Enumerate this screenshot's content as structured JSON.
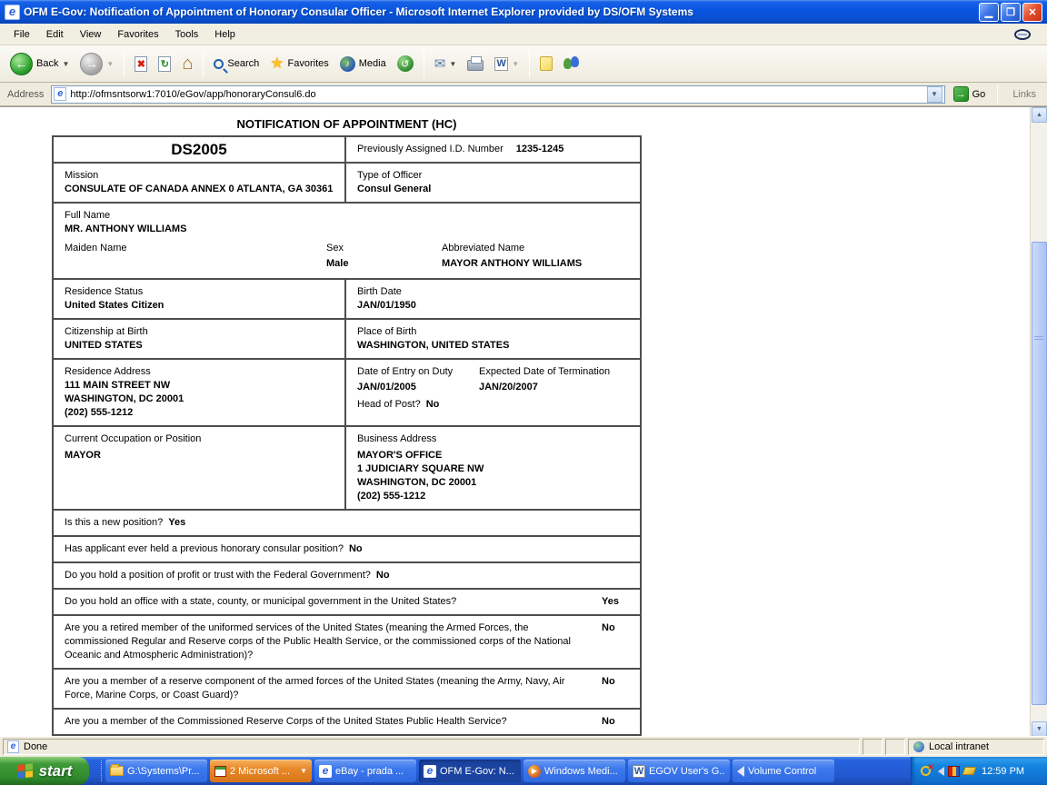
{
  "window": {
    "title": "OFM E-Gov: Notification of Appointment of Honorary Consular Officer - Microsoft Internet Explorer provided by DS/OFM Systems"
  },
  "menu_items": [
    "File",
    "Edit",
    "View",
    "Favorites",
    "Tools",
    "Help"
  ],
  "toolbar": {
    "back": "Back",
    "search": "Search",
    "favorites": "Favorites",
    "media": "Media"
  },
  "address": {
    "label": "Address",
    "url": "http://ofmsntsorw1:7010/eGov/app/honoraryConsul6.do",
    "go": "Go",
    "links": "Links"
  },
  "form": {
    "title": "NOTIFICATION OF APPOINTMENT (HC)",
    "form_number": "DS2005",
    "prev_id": {
      "label": "Previously Assigned I.D. Number",
      "value": "1235-1245"
    },
    "mission": {
      "label": "Mission",
      "value": "CONSULATE OF CANADA ANNEX 0 ATLANTA, GA 30361"
    },
    "type_of_officer": {
      "label": "Type of Officer",
      "value": "Consul General"
    },
    "full_name": {
      "label": "Full Name",
      "value": "MR. ANTHONY WILLIAMS"
    },
    "maiden_name": {
      "label": "Maiden Name",
      "value": ""
    },
    "sex": {
      "label": "Sex",
      "value": "Male"
    },
    "abbreviated_name": {
      "label": "Abbreviated Name",
      "value": "MAYOR ANTHONY WILLIAMS"
    },
    "residence_status": {
      "label": "Residence Status",
      "value": "United States Citizen"
    },
    "birth_date": {
      "label": "Birth Date",
      "value": "JAN/01/1950"
    },
    "citizenship_at_birth": {
      "label": "Citizenship at Birth",
      "value": "UNITED STATES"
    },
    "place_of_birth": {
      "label": "Place of Birth",
      "value": "WASHINGTON, UNITED STATES"
    },
    "residence_address": {
      "label": "Residence Address",
      "lines": [
        "111 MAIN STREET NW",
        "WASHINGTON, DC 20001",
        "(202) 555-1212"
      ]
    },
    "entry_on_duty": {
      "label": "Date of Entry on Duty",
      "value": "JAN/01/2005"
    },
    "termination": {
      "label": "Expected Date of Termination",
      "value": "JAN/20/2007"
    },
    "head_of_post": {
      "label": "Head of Post?",
      "value": "No"
    },
    "occupation": {
      "label": "Current Occupation or Position",
      "value": "MAYOR"
    },
    "business_address": {
      "label": "Business Address",
      "lines": [
        "MAYOR'S OFFICE",
        "1 JUDICIARY SQUARE NW",
        "WASHINGTON, DC 20001",
        "(202) 555-1212"
      ]
    },
    "questions": [
      {
        "text": "Is this a new position?",
        "answer": "Yes"
      },
      {
        "text": "Has applicant ever held a previous honorary consular position?",
        "answer": "No"
      },
      {
        "text": "Do you hold a position of profit or trust with the Federal Government?",
        "answer": "No"
      },
      {
        "text": "Do you hold an office with a state, county, or municipal government in the United States?",
        "answer": "Yes"
      },
      {
        "text": "Are you a retired member of the uniformed services of the United States (meaning the Armed Forces, the commissioned Regular and Reserve corps of the Public Health Service, or the commissioned corps of the National Oceanic and Atmospheric Administration)?",
        "answer": "No"
      },
      {
        "text": "Are you a member of a reserve component of the armed forces of the United States (meaning the Army, Navy, Air Force, Marine Corps, or Coast Guard)?",
        "answer": "No"
      },
      {
        "text": "Are you a member of the Commissioned Reserve Corps of the United States Public Health Service?",
        "answer": "No"
      }
    ]
  },
  "status": {
    "done": "Done",
    "zone": "Local intranet"
  },
  "taskbar": {
    "start": "start",
    "tasks": [
      {
        "label": "G:\\Systems\\Pr..."
      },
      {
        "label": "2 Microsoft ..."
      },
      {
        "label": "eBay - prada ..."
      },
      {
        "label": "OFM E-Gov: N..."
      },
      {
        "label": "Windows Medi..."
      },
      {
        "label": "EGOV User's G..."
      },
      {
        "label": "Volume Control"
      }
    ],
    "time": "12:59 PM"
  }
}
